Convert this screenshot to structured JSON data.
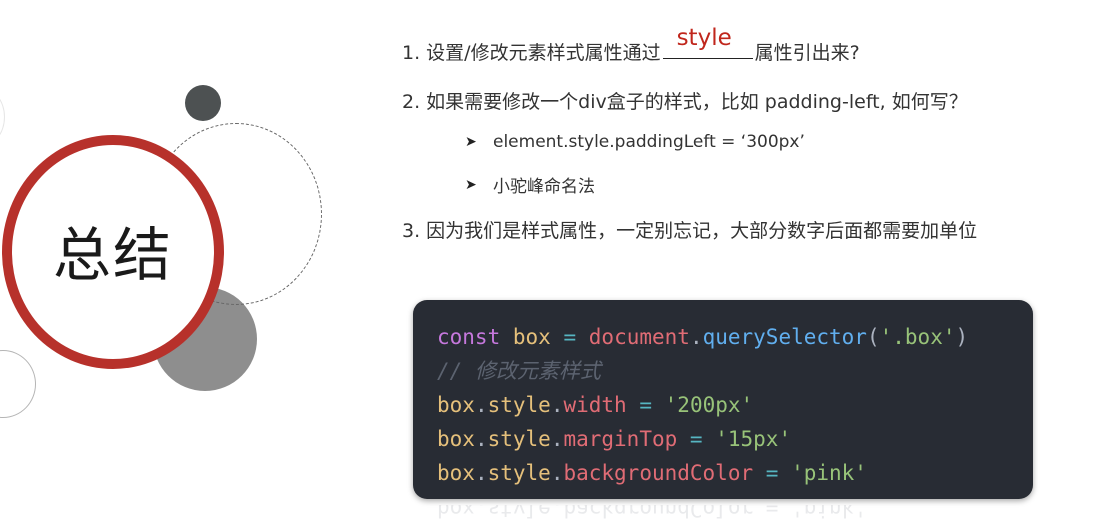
{
  "title": "总结",
  "questions": {
    "q1_prefix": "1. 设置/修改元素样式属性通过",
    "q1_answer": "style",
    "q1_suffix": "属性引出来?",
    "q2": "2. 如果需要修改一个div盒子的样式，比如 padding-left, 如何写？",
    "q2_points": [
      "element.style.paddingLeft = ‘300px’",
      "小驼峰命名法"
    ],
    "q3": "3. 因为我们是样式属性，一定别忘记，大部分数字后面都需要加单位"
  },
  "code": {
    "l1": {
      "kw": "const",
      "var": "box",
      "eq": "=",
      "obj": "document",
      "dot": ".",
      "fn": "querySelector",
      "open": "(",
      "str": "'.box'",
      "close": ")"
    },
    "l2": {
      "comment": "// 修改元素样式"
    },
    "l3": {
      "obj": "box",
      "dot1": ".",
      "prop": "style",
      "dot2": ".",
      "key": "width",
      "eq": "=",
      "val": "'200px'"
    },
    "l4": {
      "obj": "box",
      "dot1": ".",
      "prop": "style",
      "dot2": ".",
      "key": "marginTop",
      "eq": "=",
      "val": "'15px'"
    },
    "l5": {
      "obj": "box",
      "dot1": ".",
      "prop": "style",
      "dot2": ".",
      "key": "backgroundColor",
      "eq": "=",
      "val": "'pink'"
    }
  },
  "icons": {
    "bullet": "arrow-bullet-icon"
  },
  "colors": {
    "accent": "#b7312b",
    "answer": "#c0261c",
    "code_bg": "#282c34"
  }
}
